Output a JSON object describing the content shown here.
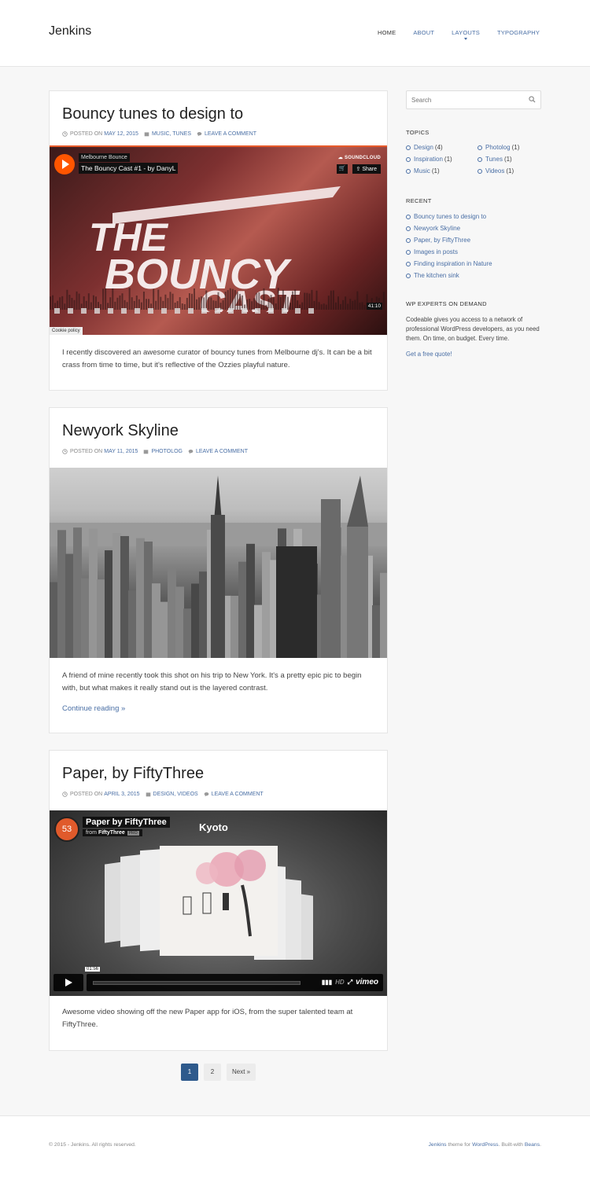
{
  "site": {
    "title": "Jenkins"
  },
  "nav": {
    "items": [
      {
        "label": "HOME"
      },
      {
        "label": "ABOUT"
      },
      {
        "label": "LAYOUTS"
      },
      {
        "label": "TYPOGRAPHY"
      }
    ]
  },
  "posts": [
    {
      "title": "Bouncy tunes to design to",
      "posted_on_label": "POSTED ON",
      "date": "MAY 12, 2015",
      "categories": "MUSIC, TUNES",
      "comment_label": "LEAVE A COMMENT",
      "excerpt": "I recently discovered an awesome curator of bouncy tunes from Melbourne dj's. It can be a bit crass from time to time, but it's reflective of the Ozzies playful nature.",
      "embed": {
        "user": "Melbourne Bounce",
        "track": "The Bouncy Cast #1 - by DanyL",
        "brand": "SOUNDCLOUD",
        "share_label": "Share",
        "duration": "41:10",
        "cookie_label": "Cookie policy",
        "art_line1": "THE",
        "art_line2": "BOUNCY",
        "art_line3": "CAST"
      }
    },
    {
      "title": "Newyork Skyline",
      "posted_on_label": "POSTED ON",
      "date": "MAY 11, 2015",
      "categories": "PHOTOLOG",
      "comment_label": "LEAVE A COMMENT",
      "excerpt": "A friend of mine recently took this shot on his trip to New York. It's a pretty epic pic to begin with, but what makes it really stand out is the layered contrast.",
      "continue_label": "Continue reading »"
    },
    {
      "title": "Paper, by FiftyThree",
      "posted_on_label": "POSTED ON",
      "date": "APRIL 3, 2015",
      "categories": "DESIGN, VIDEOS",
      "comment_label": "LEAVE A COMMENT",
      "excerpt": "Awesome video showing off the new Paper app for iOS, from the super talented team at FiftyThree.",
      "embed": {
        "badge": "53",
        "video_title": "Paper by FiftyThree",
        "from_label": "from",
        "author": "FiftyThree",
        "pro_label": "PRO",
        "overlay_title": "Kyoto",
        "time": "01:56",
        "hd_label": "HD",
        "brand": "vimeo"
      }
    }
  ],
  "pagination": {
    "pages": [
      "1",
      "2"
    ],
    "next_label": "Next »"
  },
  "sidebar": {
    "search_placeholder": "Search",
    "topics_title": "TOPICS",
    "topics": [
      {
        "label": "Design",
        "count": "(4)"
      },
      {
        "label": "Inspiration",
        "count": "(1)"
      },
      {
        "label": "Music",
        "count": "(1)"
      },
      {
        "label": "Photolog",
        "count": "(1)"
      },
      {
        "label": "Tunes",
        "count": "(1)"
      },
      {
        "label": "Videos",
        "count": "(1)"
      }
    ],
    "recent_title": "RECENT",
    "recent": [
      "Bouncy tunes to design to",
      "Newyork Skyline",
      "Paper, by FiftyThree",
      "Images in posts",
      "Finding inspiration in Nature",
      "The kitchen sink"
    ],
    "experts_title": "WP EXPERTS ON DEMAND",
    "experts_text": "Codeable gives you access to a network of professional WordPress developers, as you need them. On time, on budget. Every time.",
    "experts_link": "Get a free quote!"
  },
  "footer": {
    "copyright": "© 2015 - Jenkins. All rights reserved.",
    "credit_theme": "Jenkins",
    "credit_mid": " theme for ",
    "credit_wp": "WordPress",
    "credit_built": ". Built-with ",
    "credit_beans": "Beans",
    "credit_end": "."
  },
  "colors": {
    "accent": "#4a6fa5",
    "current_page": "#2e5a8c",
    "soundcloud": "#ff5500"
  }
}
